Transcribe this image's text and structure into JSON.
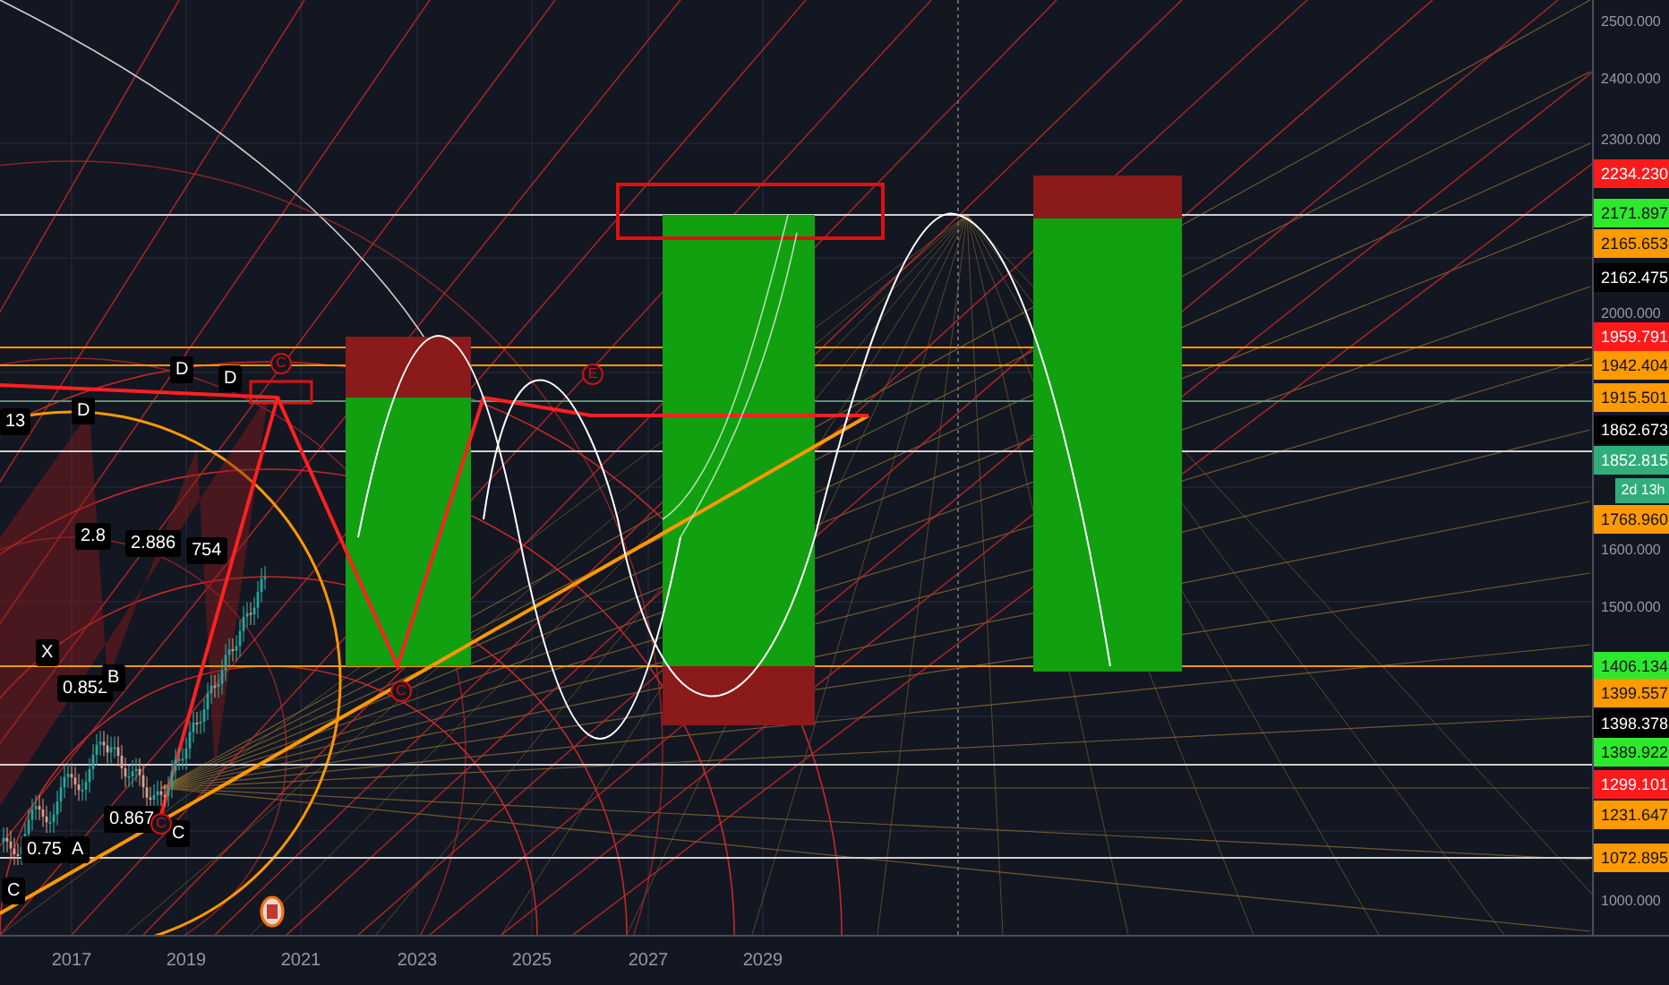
{
  "price_axis": {
    "ticks": [
      "2500.000",
      "2400.000",
      "2300.000",
      "2000.000",
      "1600.000",
      "1500.000",
      "1000.000"
    ],
    "labels": [
      {
        "text": "2234.230",
        "color": "#ff1a1a"
      },
      {
        "text": "2171.897",
        "color": "#2ee82e"
      },
      {
        "text": "2165.653",
        "color": "#ff9a00"
      },
      {
        "text": "2162.475",
        "color": "#000000"
      },
      {
        "text": "1959.791",
        "color": "#ff1a1a"
      },
      {
        "text": "1942.404",
        "color": "#ff9a00"
      },
      {
        "text": "1915.501",
        "color": "#ff9a00"
      },
      {
        "text": "1862.673",
        "color": "#000000"
      },
      {
        "text": "1852.815",
        "color": "#2fae7a"
      },
      {
        "text": "1768.960",
        "color": "#ff9a00"
      },
      {
        "text": "1406.134",
        "color": "#2ee82e"
      },
      {
        "text": "1399.557",
        "color": "#ff9a00"
      },
      {
        "text": "1398.378",
        "color": "#000000"
      },
      {
        "text": "1389.922",
        "color": "#2ee82e"
      },
      {
        "text": "1299.101",
        "color": "#ff1a1a"
      },
      {
        "text": "1231.647",
        "color": "#ff9a00"
      },
      {
        "text": "1072.895",
        "color": "#ff9a00"
      }
    ],
    "countdown": "2d 13h"
  },
  "time_axis": {
    "ticks": [
      "2017",
      "2019",
      "2021",
      "2023",
      "2025",
      "2027",
      "2029"
    ]
  },
  "pattern_labels": [
    "D",
    "D",
    "13",
    "D",
    "2.8",
    "2.886",
    "754",
    "X",
    "0.852",
    "B",
    "0.867",
    "C",
    "0.75",
    "A",
    "C"
  ],
  "point_marks": [
    "C",
    "E",
    "C",
    "C"
  ]
}
